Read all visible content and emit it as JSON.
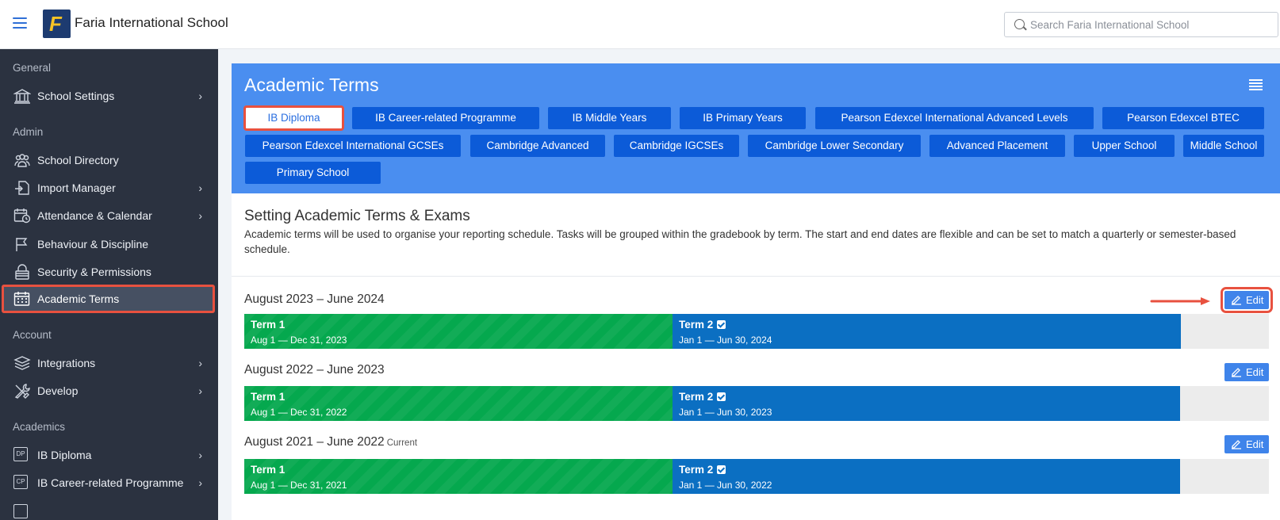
{
  "app": {
    "title": "Faria International School",
    "logo_letter": "F"
  },
  "search": {
    "placeholder": "Search Faria International School"
  },
  "sidebar": {
    "sections": {
      "general": "General",
      "admin": "Admin",
      "account": "Account",
      "academics": "Academics"
    },
    "items": [
      {
        "label": "School Settings",
        "icon": "bank-icon",
        "chevron": true
      },
      {
        "label": "School Directory",
        "icon": "people-icon",
        "chevron": false
      },
      {
        "label": "Import Manager",
        "icon": "import-icon",
        "chevron": true
      },
      {
        "label": "Attendance & Calendar",
        "icon": "calendar-clock-icon",
        "chevron": true
      },
      {
        "label": "Behaviour & Discipline",
        "icon": "flag-icon",
        "chevron": false
      },
      {
        "label": "Security & Permissions",
        "icon": "lock-icon",
        "chevron": false
      },
      {
        "label": "Academic Terms",
        "icon": "calendar-icon",
        "chevron": false,
        "active": true
      },
      {
        "label": "Integrations",
        "icon": "layers-icon",
        "chevron": true
      },
      {
        "label": "Develop",
        "icon": "tools-icon",
        "chevron": true
      },
      {
        "label": "IB Diploma",
        "icon": "dp-icon",
        "badge": "DP",
        "chevron": true
      },
      {
        "label": "IB Career-related Programme",
        "icon": "cp-icon",
        "badge": "CP",
        "chevron": true
      }
    ]
  },
  "page": {
    "title": "Academic Terms",
    "programmes": [
      "IB Diploma",
      "IB Career-related Programme",
      "IB Middle Years",
      "IB Primary Years",
      "Pearson Edexcel International Advanced Levels",
      "Pearson Edexcel BTEC",
      "Pearson Edexcel International GCSEs",
      "Cambridge Advanced",
      "Cambridge IGCSEs",
      "Cambridge Lower Secondary",
      "Advanced Placement",
      "Upper School",
      "Middle School",
      "Primary School"
    ],
    "selected_programme": "IB Diploma",
    "section_title": "Setting Academic Terms & Exams",
    "section_desc": "Academic terms will be used to organise your reporting schedule. Tasks will be grouped within the gradebook by term. The start and end dates are flexible and can be set to match a quarterly or semester-based schedule.",
    "edit_label": "Edit",
    "years": [
      {
        "title": "August 2023 – June 2024",
        "current": "",
        "terms": [
          {
            "name": "Term 1",
            "dates": "Aug 1 — Dec 31, 2023",
            "checked": false
          },
          {
            "name": "Term 2",
            "dates": "Jan 1 — Jun 30, 2024",
            "checked": true
          }
        ]
      },
      {
        "title": "August 2022 – June 2023",
        "current": "",
        "terms": [
          {
            "name": "Term 1",
            "dates": "Aug 1 — Dec 31, 2022",
            "checked": false
          },
          {
            "name": "Term 2",
            "dates": "Jan 1 — Jun 30, 2023",
            "checked": true
          }
        ]
      },
      {
        "title": "August 2021 – June 2022",
        "current": "Current",
        "terms": [
          {
            "name": "Term 1",
            "dates": "Aug 1 — Dec 31, 2021",
            "checked": false
          },
          {
            "name": "Term 2",
            "dates": "Jan 1 — Jun 30, 2022",
            "checked": true
          }
        ]
      }
    ]
  },
  "colors": {
    "sidebar_bg": "#2b3240",
    "header_blue": "#4a8ef0",
    "button_blue": "#0c5bd8",
    "term1_green": "#05a84e",
    "term2_blue": "#0b6fc2",
    "highlight_red": "#e8513f"
  }
}
